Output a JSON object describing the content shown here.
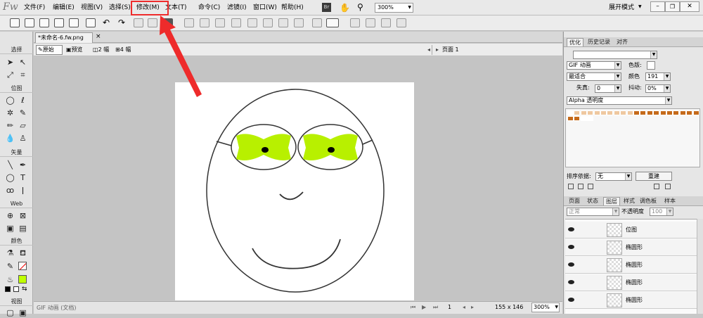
{
  "app": {
    "logo": "Fw"
  },
  "menu": {
    "items": [
      "文件(F)",
      "编辑(E)",
      "视图(V)",
      "选择(S)",
      "修改(M)",
      "文本(T)",
      "命令(C)",
      "滤镜(I)",
      "窗口(W)",
      "帮助(H)"
    ],
    "br_label": "Br",
    "zoom": "300%",
    "workspace": "展开模式"
  },
  "tools": {
    "sections": [
      "选择",
      "位图",
      "矢量",
      "Web",
      "颜色",
      "视图"
    ]
  },
  "document": {
    "tab": "*未命名-6.fw.png",
    "views": [
      "原始",
      "预览",
      "2 幅",
      "4 幅"
    ],
    "page": "页面 1"
  },
  "status": {
    "left": "GIF 动画 (文档)",
    "frame": "1",
    "size": "155 x 146",
    "zoom": "300%"
  },
  "panel": {
    "top_tabs": [
      "优化",
      "历史记录",
      "对齐"
    ],
    "format": "GIF 动画",
    "palette": "最适合",
    "lossy_label": "失真:",
    "lossy_value": "0",
    "colors_label": "颜色",
    "colors_value": "191",
    "dither_label": "抖动:",
    "dither_value": "0%",
    "matte_label": "色版:",
    "transparency": "Alpha 透明度",
    "sort_label": "排序依据:",
    "sort_value": "无",
    "rebuild": "重建",
    "layer_tabs": [
      "页面",
      "状态",
      "图层",
      "样式",
      "调色板",
      "样本"
    ],
    "blend_mode": "正常",
    "opacity_label": "不透明度",
    "opacity_value": "100",
    "layers": [
      "位图",
      "椭圆形",
      "椭圆形",
      "椭圆形",
      "椭圆形"
    ]
  },
  "colors": {
    "fill": "#bfff00",
    "lenses": "#b8f000",
    "swatch_dark": "#c56a1a",
    "swatch_light": "#efc8a0",
    "annotation": "#ee2b2b"
  }
}
